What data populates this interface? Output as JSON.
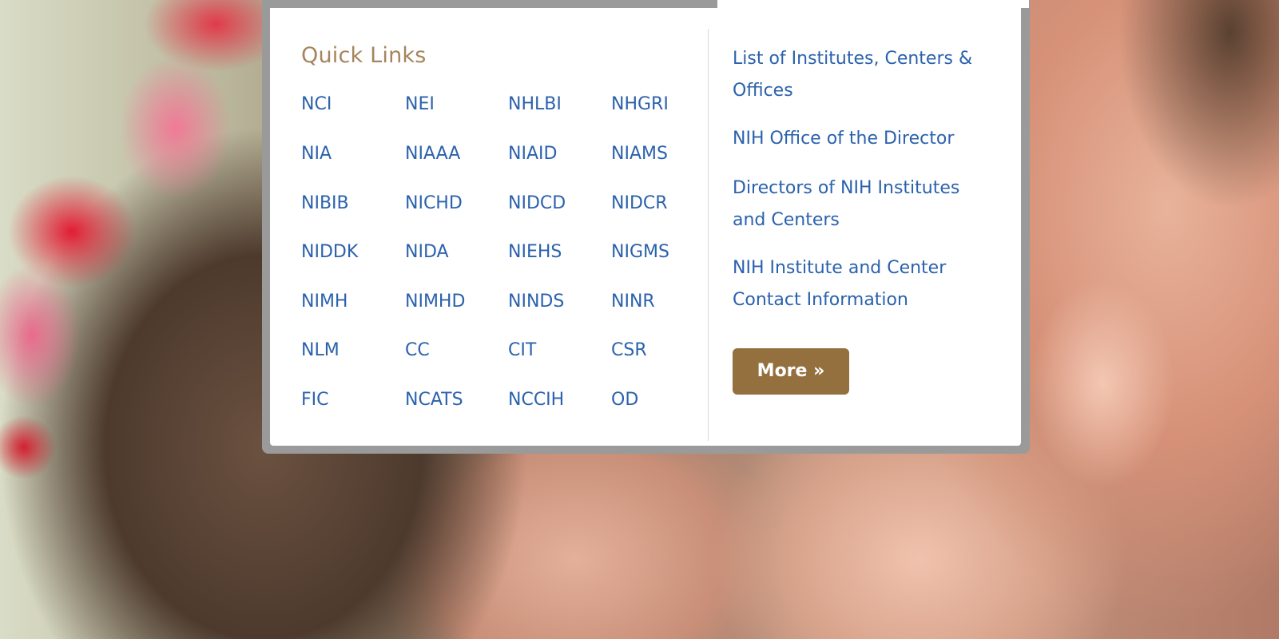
{
  "quick_links": {
    "title": "Quick Links",
    "grid": [
      [
        "NCI",
        "NEI",
        "NHLBI",
        "NHGRI"
      ],
      [
        "NIA",
        "NIAAA",
        "NIAID",
        "NIAMS"
      ],
      [
        "NIBIB",
        "NICHD",
        "NIDCD",
        "NIDCR"
      ],
      [
        "NIDDK",
        "NIDA",
        "NIEHS",
        "NIGMS"
      ],
      [
        "NIMH",
        "NIMHD",
        "NINDS",
        "NINR"
      ],
      [
        "NLM",
        "CC",
        "CIT",
        "CSR"
      ],
      [
        "FIC",
        "NCATS",
        "NCCIH",
        "OD"
      ]
    ],
    "related": [
      "List of Institutes, Centers & Offices",
      "NIH Office of the Director",
      "Directors of NIH Institutes and Centers",
      "NIH Institute and Center Contact Information"
    ],
    "more_label": "More »"
  },
  "colors": {
    "link": "#2b62ad",
    "title": "#a5855c",
    "button": "#94703f"
  }
}
